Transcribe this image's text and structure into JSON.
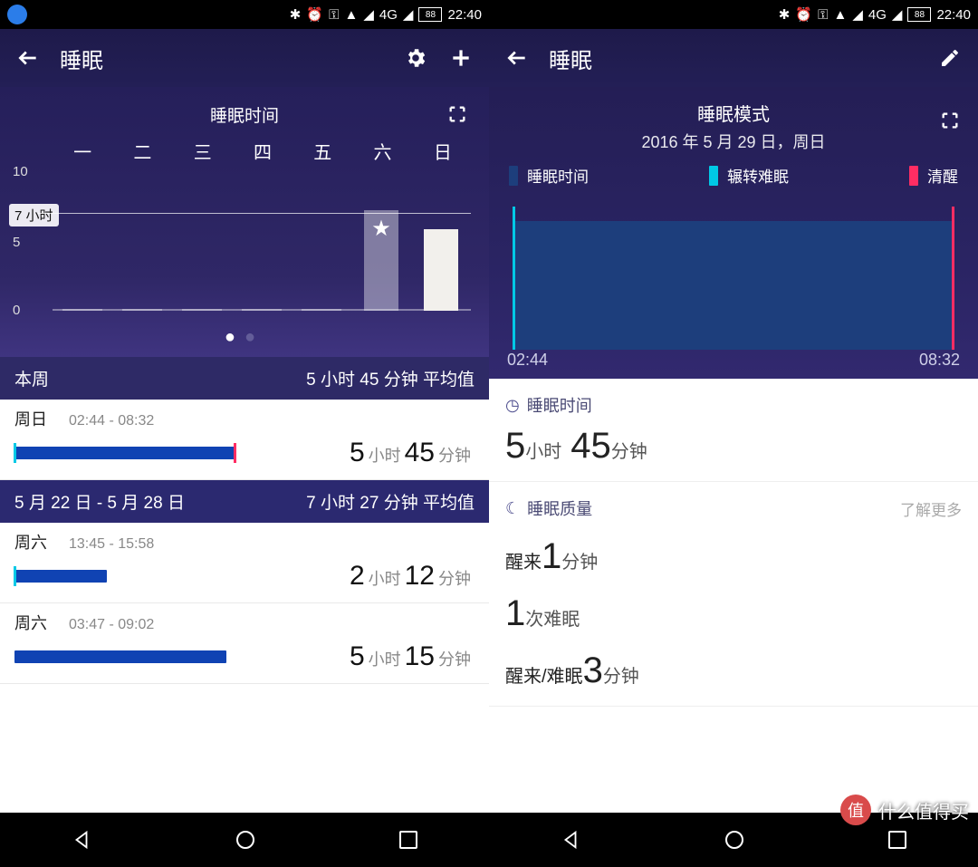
{
  "statusbar": {
    "time": "22:40",
    "battery": "88",
    "network": "4G"
  },
  "left": {
    "title": "睡眠",
    "chart_title": "睡眠时间",
    "goal_label": "7 小时",
    "sections": [
      {
        "header": "本周",
        "avg": "5 小时 45 分钟 平均值",
        "entries": [
          {
            "day": "周日",
            "range": "02:44 - 08:32",
            "h": "5",
            "hunit": "小时",
            "m": "45",
            "munit": "分钟",
            "bar_pct": 48,
            "start_tick": "#00c9e6",
            "end_tick": "#ff2d63"
          }
        ]
      },
      {
        "header": "5 月 22 日 - 5 月 28 日",
        "avg": "7 小时 27 分钟 平均值",
        "entries": [
          {
            "day": "周六",
            "range": "13:45 - 15:58",
            "h": "2",
            "hunit": "小时",
            "m": "12",
            "munit": "分钟",
            "bar_pct": 20,
            "start_tick": "#00c9e6"
          },
          {
            "day": "周六",
            "range": "03:47 - 09:02",
            "h": "5",
            "hunit": "小时",
            "m": "15",
            "munit": "分钟",
            "bar_pct": 46
          }
        ]
      }
    ]
  },
  "right": {
    "title": "睡眠",
    "mode_title": "睡眠模式",
    "date": "2016 年 5 月 29 日，周日",
    "legend": {
      "asleep": "睡眠时间",
      "restless": "辗转难眠",
      "awake": "清醒"
    },
    "colors": {
      "asleep": "#1d3e7c",
      "restless": "#00c9e6",
      "awake": "#ff2d63"
    },
    "times": {
      "start": "02:44",
      "end": "08:32"
    },
    "duration": {
      "label": "睡眠时间",
      "h": "5",
      "hunit": "小时",
      "m": "45",
      "munit": "分钟"
    },
    "quality": {
      "label": "睡眠质量",
      "more": "了解更多",
      "l1_pre": "醒来",
      "l1_num": "1",
      "l1_suf": "分钟",
      "l2_num": "1",
      "l2_suf": "次难眠",
      "l3_pre": "醒来/难眠",
      "l3_num": "3",
      "l3_suf": "分钟"
    }
  },
  "watermark": "什么值得买",
  "chart_data": {
    "type": "bar",
    "title": "睡眠时间",
    "categories": [
      "一",
      "二",
      "三",
      "四",
      "五",
      "六",
      "日"
    ],
    "values": [
      0,
      0,
      0,
      0,
      0,
      7.4,
      6.0
    ],
    "goal": 7,
    "highlight_index": 5,
    "ylim": [
      0,
      10
    ],
    "yticks": [
      0,
      5,
      10
    ],
    "ylabel": "小时"
  }
}
